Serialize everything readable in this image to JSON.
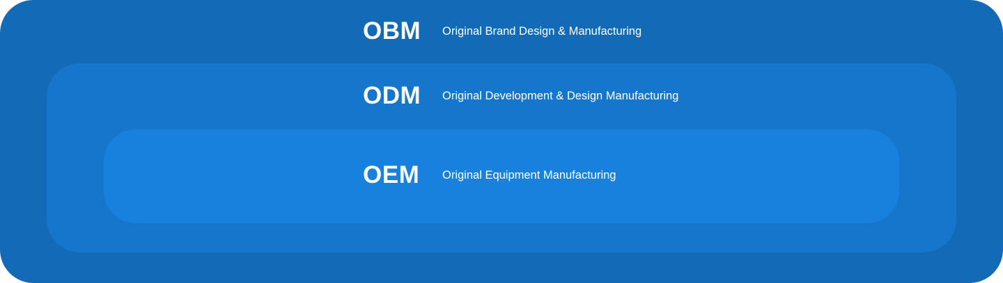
{
  "layers": [
    {
      "abbr": "OBM",
      "description": "Original Brand Design & Manufacturing",
      "color": "#136ab6"
    },
    {
      "abbr": "ODM",
      "description": "Original Development & Design Manufacturing",
      "color": "#1576cb"
    },
    {
      "abbr": "OEM",
      "description": "Original Equipment Manufacturing",
      "color": "#1881de"
    }
  ]
}
